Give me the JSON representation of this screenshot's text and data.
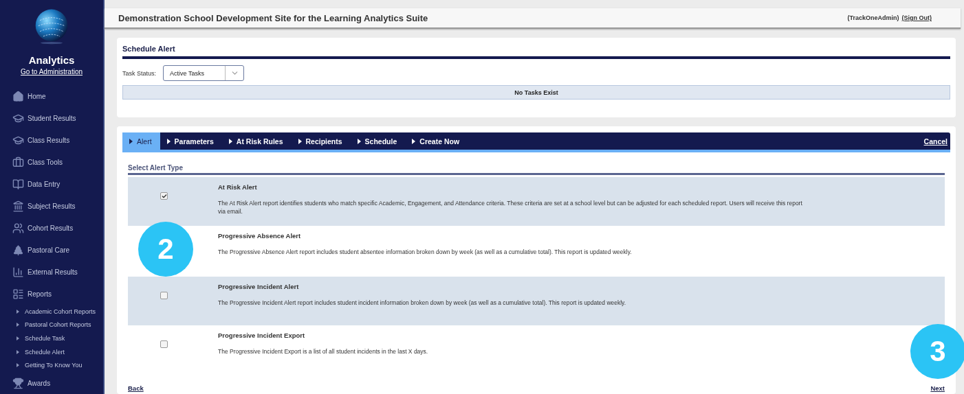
{
  "sidebar": {
    "title": "Analytics",
    "admin_link": "Go to Administration",
    "items": [
      {
        "label": "Home"
      },
      {
        "label": "Student Results"
      },
      {
        "label": "Class Results"
      },
      {
        "label": "Class Tools"
      },
      {
        "label": "Data Entry"
      },
      {
        "label": "Subject Results"
      },
      {
        "label": "Cohort Results"
      },
      {
        "label": "Pastoral Care"
      },
      {
        "label": "External Results"
      },
      {
        "label": "Reports",
        "children": [
          {
            "label": "Academic Cohort Reports"
          },
          {
            "label": "Pastoral Cohort Reports"
          },
          {
            "label": "Schedule Task"
          },
          {
            "label": "Schedule Alert"
          },
          {
            "label": "Getting To Know You"
          }
        ]
      },
      {
        "label": "Awards"
      }
    ]
  },
  "header": {
    "title": "Demonstration School Development Site for the Learning Analytics Suite",
    "user": "(TrackOneAdmin)",
    "sign_out": "(Sign Out)"
  },
  "schedule_panel": {
    "title": "Schedule Alert",
    "status_label": "Task Status:",
    "status_value": "Active Tasks",
    "notice": "No Tasks Exist"
  },
  "wizard": {
    "tabs": [
      {
        "label": "Alert",
        "selected": true
      },
      {
        "label": "Parameters",
        "selected": false
      },
      {
        "label": "At Risk Rules",
        "selected": false
      },
      {
        "label": "Recipients",
        "selected": false
      },
      {
        "label": "Schedule",
        "selected": false
      },
      {
        "label": "Create Now",
        "selected": false
      }
    ],
    "cancel": "Cancel",
    "section_title": "Select Alert Type",
    "alerts": [
      {
        "title": "At Risk Alert",
        "description": "The At Risk Alert report identifies students who match specific Academic, Engagement, and Attendance criteria. These criteria are set at a school level but can be adjusted for each scheduled report. Users will receive this report via email.",
        "checked": true
      },
      {
        "title": "Progressive Absence Alert",
        "description": "The Progressive Absence Alert report includes student absentee information broken down by week (as well as a cumulative total). This report is updated weekly."
      },
      {
        "title": "Progressive Incident Alert",
        "description": "The Progressive Incident Alert report includes student incident information broken down by week (as well as a cumulative total). This report is updated weekly.",
        "checked": false
      },
      {
        "title": "Progressive Incident Export",
        "description": "The Progressive Incident Export is a list of all student incidents in the last X days.",
        "checked": false
      }
    ],
    "back": "Back",
    "next": "Next"
  },
  "callouts": [
    "2",
    "3"
  ]
}
